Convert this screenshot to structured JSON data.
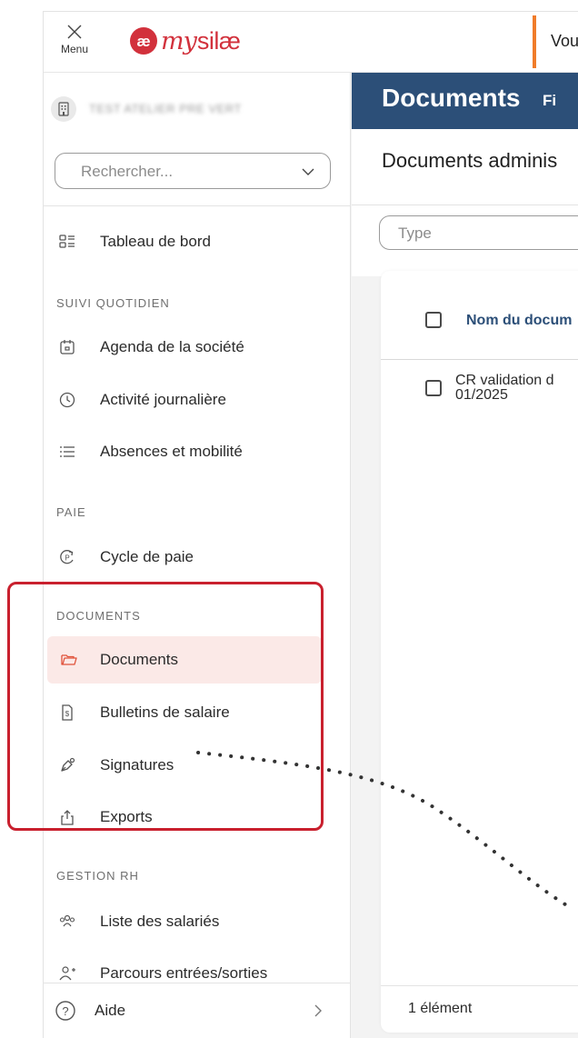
{
  "topbar": {
    "menu_label": "Menu",
    "logo_text_my": "my",
    "logo_text_silae": "silæ",
    "banner_text": "Vou",
    "banner_accent": "#f07c2a",
    "brand_color": "#d2313c"
  },
  "sidebar": {
    "company_name": "TEST ATELIER PRE VERT",
    "search_placeholder": "Rechercher...",
    "dashboard_label": "Tableau de bord",
    "sections": {
      "daily": "Suivi quotidien",
      "payroll": "Paie",
      "documents": "Documents",
      "hr": "Gestion RH"
    },
    "items": {
      "agenda": "Agenda de la société",
      "activity": "Activité journalière",
      "absences": "Absences et mobilité",
      "payroll_cycle": "Cycle de paie",
      "documents": "Documents",
      "payslips": "Bulletins de salaire",
      "signatures": "Signatures",
      "exports": "Exports",
      "employees": "Liste des salariés",
      "onboarding": "Parcours entrées/sorties"
    },
    "help_label": "Aide",
    "active_item": "documents",
    "active_bg": "#fbe9e7"
  },
  "main": {
    "header_title": "Documents",
    "header_tab": "Fi",
    "header_color": "#2c4f78",
    "subheader_title": "Documents adminis",
    "type_placeholder": "Type",
    "table": {
      "column_header": "Nom du docum",
      "rows": [
        {
          "line1": "CR validation d",
          "line2": "01/2025"
        }
      ]
    },
    "count_label": "1 élément"
  },
  "annotation": {
    "highlight_color": "#c9202e"
  }
}
